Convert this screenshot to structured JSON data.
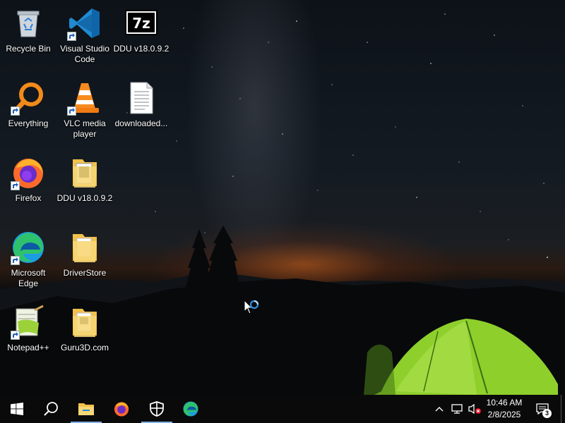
{
  "desktop": {
    "icons": [
      {
        "label": "Recycle Bin"
      },
      {
        "label": "Visual Studio Code"
      },
      {
        "label": "DDU v18.0.9.2"
      },
      {
        "label": "Everything"
      },
      {
        "label": "VLC media player"
      },
      {
        "label": "downloaded..."
      },
      {
        "label": "Firefox"
      },
      {
        "label": "DDU v18.0.9.2"
      },
      {
        "label": "Microsoft Edge"
      },
      {
        "label": "DriverStore"
      },
      {
        "label": "Notepad++"
      },
      {
        "label": "Guru3D.com"
      }
    ]
  },
  "taskbar": {
    "pinned": [
      "start",
      "search",
      "file-explorer",
      "firefox",
      "security",
      "microsoft-edge"
    ],
    "clock": {
      "time": "10:46 AM",
      "date": "2/8/2025"
    },
    "notifications": {
      "count": "3"
    }
  },
  "colors": {
    "taskbar": "#0a0a0a",
    "tent": "#8ecf2c",
    "sunset": "#d66820",
    "accent": "#7fb2e5"
  }
}
